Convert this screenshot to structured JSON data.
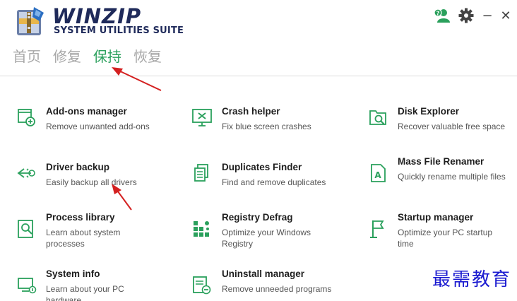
{
  "app": {
    "name_line1": "WINZIP",
    "name_line2": "SYSTEM UTILITIES SUITE"
  },
  "nav": {
    "tabs": [
      {
        "label": "首页",
        "active": false
      },
      {
        "label": "修复",
        "active": false
      },
      {
        "label": "保持",
        "active": true
      },
      {
        "label": "恢复",
        "active": false
      }
    ]
  },
  "window_controls": {
    "minimize": "−",
    "close": "✕"
  },
  "tools": [
    {
      "title": "Add-ons manager",
      "desc": "Remove unwanted add-ons",
      "icon": "addons-icon"
    },
    {
      "title": "Crash helper",
      "desc": "Fix blue screen crashes",
      "icon": "crash-icon"
    },
    {
      "title": "Disk Explorer",
      "desc": "Recover valuable free space",
      "icon": "disk-explorer-icon"
    },
    {
      "title": "Driver backup",
      "desc": "Easily backup all drivers",
      "icon": "driver-backup-icon"
    },
    {
      "title": "Duplicates Finder",
      "desc": "Find and remove duplicates",
      "icon": "duplicates-icon"
    },
    {
      "title": "Mass File Renamer",
      "desc": "Quickly rename multiple files",
      "icon": "renamer-icon"
    },
    {
      "title": "Process library",
      "desc": "Learn about system processes",
      "icon": "process-icon"
    },
    {
      "title": "Registry Defrag",
      "desc": "Optimize your Windows Registry",
      "icon": "registry-icon"
    },
    {
      "title": "Startup manager",
      "desc": "Optimize your PC startup time",
      "icon": "startup-icon"
    },
    {
      "title": "System info",
      "desc": "Learn about your PC hardware",
      "icon": "sysinfo-icon"
    },
    {
      "title": "Uninstall manager",
      "desc": "Remove unneeded programs",
      "icon": "uninstall-icon"
    }
  ],
  "colors": {
    "accent": "#2aa05c",
    "inactive_tab": "#a7a7a7",
    "brand": "#1f2a5a",
    "arrow": "#d42020"
  },
  "watermark": "最需教育"
}
